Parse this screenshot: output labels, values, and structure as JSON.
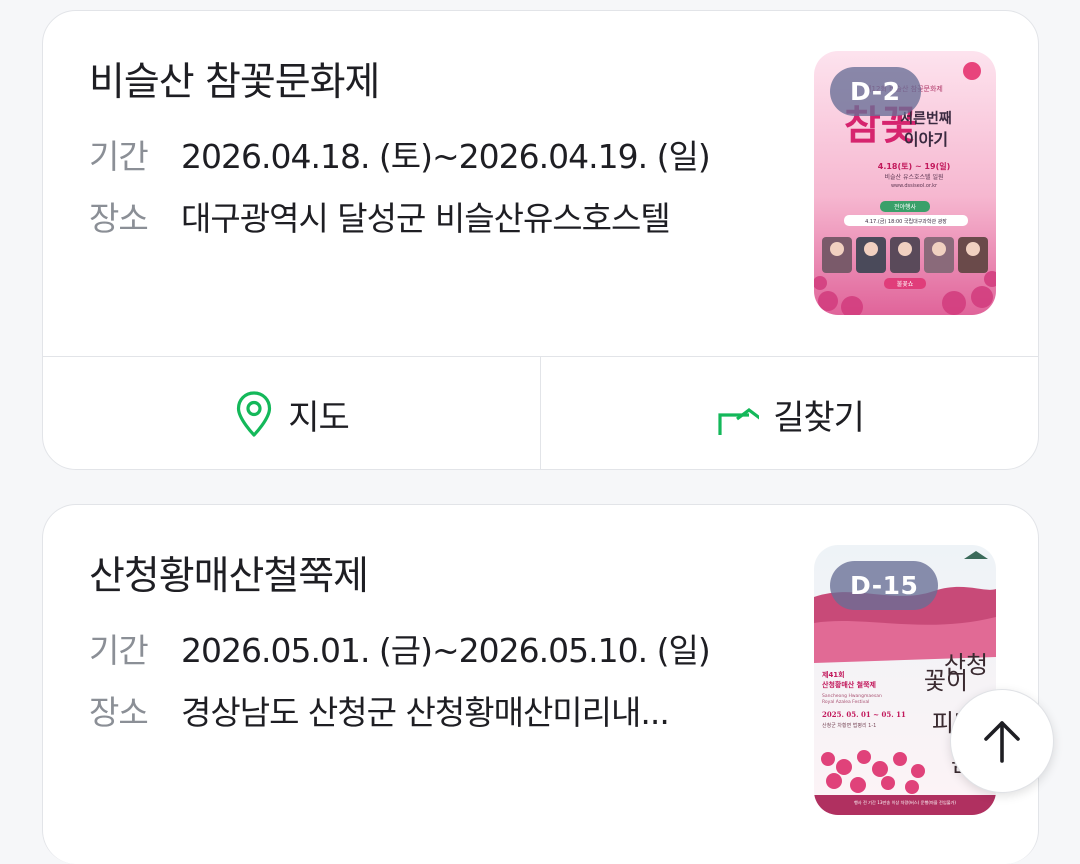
{
  "festivals": [
    {
      "title": "비슬산 참꽃문화제",
      "period_label": "기간",
      "period": "2026.04.18. (토)~2026.04.19. (일)",
      "place_label": "장소",
      "place": "대구광역시 달성군 비슬산유스호스텔",
      "dday": "D-2",
      "poster": {
        "event_no": "제12회 비슬산 참꽃문화제",
        "title_big": "참꽃",
        "title_sub": "서른번째 이야기",
        "dates": "4.18(토) ~ 19(일)",
        "venue": "비슬산 유스호스텔 일원",
        "site": "www.dssiseol.or.kr",
        "eve_label": "전야행사",
        "eve_detail": "4.17.(금) 18:00 국립대구과학관 광장",
        "show_label": "불꽃쇼"
      }
    },
    {
      "title": "산청황매산철쭉제",
      "period_label": "기간",
      "period": "2026.05.01. (금)~2026.05.10. (일)",
      "place_label": "장소",
      "place": "경상남도 산청군 산청황매산미리내...",
      "dday": "D-15",
      "poster": {
        "event_no": "제41회",
        "title_ko": "산청황매산 철쭉제",
        "title_en": "Sancheong Hwangmaesan Royal Azalea Festival",
        "dates": "2025. 05. 01 ~ 05. 11",
        "host": "산청군 차황면 법평리 1-1",
        "vertical_1": "산청",
        "vertical_2": "꽃이",
        "vertical_3": "피나",
        "vertical_4": "봄",
        "footer": "행사 전 기간 13만송 이상 차량(버스) 운행(마을 전입불가)"
      }
    }
  ],
  "actions": {
    "map_label": "지도",
    "directions_label": "길찾기"
  },
  "colors": {
    "accent_green": "#14b85a",
    "dday_bg": "#686e96"
  },
  "icons": {
    "map": "location-pin-icon",
    "directions": "turn-arrow-icon",
    "scroll_top": "arrow-up-icon"
  }
}
